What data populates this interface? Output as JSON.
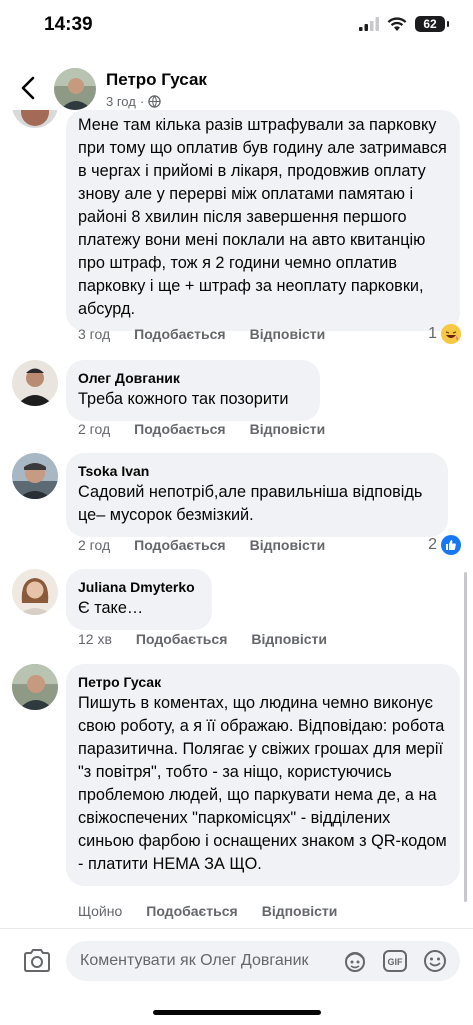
{
  "status": {
    "time": "14:39",
    "battery": "62"
  },
  "header": {
    "name": "Петро Гусак",
    "time": "3 год",
    "separator": "·"
  },
  "comments": [
    {
      "text": "Мене там кілька разів штрафували за парковку при тому що оплатив був годину але затримався в чергах і прийомі в лікаря, продовжив оплату знову але у перерві між оплатами памятаю і районі 8 хвилин після завершення першого платежу вони мені поклали на авто квитанцію про штраф, тож я 2 години чемно оплатив парковку і ще + штраф за неоплату парковки, абсурд.",
      "time": "3 год",
      "like": "Подобається",
      "reply": "Відповісти",
      "reactions": "1"
    },
    {
      "author": "Олег Довганик",
      "text": "Треба кожного так позорити",
      "time": "2 год",
      "like": "Подобається",
      "reply": "Відповісти"
    },
    {
      "author": "Tsoka Ivan",
      "text": "Садовий непотріб,але правильніша відповідь це– мусорок безмізкий.",
      "time": "2 год",
      "like": "Подобається",
      "reply": "Відповісти",
      "reactions": "2"
    },
    {
      "author": "Juliana Dmyterko",
      "text": "Є таке…",
      "time": "12 хв",
      "like": "Подобається",
      "reply": "Відповісти"
    },
    {
      "author": "Петро Гусак",
      "text": "Пишуть в коментах, що людина чемно виконує свою роботу, а я її ображаю. Відповідаю: робота паразитична. Полягає у свіжих грошах для мерії \"з повітря\", тобто - за ніщо, користуючись проблемою людей, що паркувати нема де, а на свіжоспечених \"паркомісцях\" - відділених синьою фарбою і оснащених знаком з QR-кодом - платити НЕМА ЗА ЩО.",
      "time": "Щойно",
      "like": "Подобається",
      "reply": "Відповісти"
    }
  ],
  "composer": {
    "placeholder": "Коментувати як Олег Довганик"
  },
  "icons": {
    "back": "chevron-left-icon",
    "globe": "globe-icon",
    "camera": "camera-icon",
    "avatar_sticker": "avatar-sticker-icon",
    "gif": "gif-icon",
    "emoji": "smile-icon",
    "reaction_haha": "haha-emoji-icon",
    "reaction_like": "like-icon"
  },
  "colors": {
    "accent": "#1877f2",
    "bubble": "#f0f2f5",
    "secondary_text": "#65676b"
  }
}
